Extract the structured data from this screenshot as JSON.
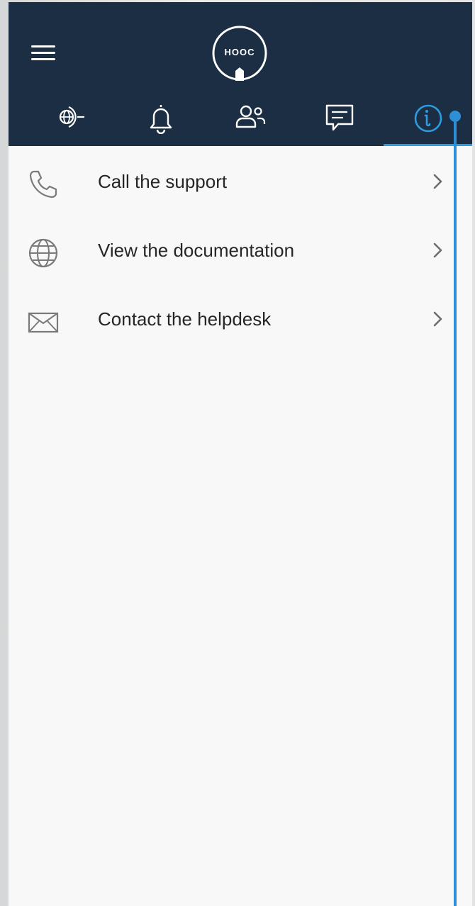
{
  "app": {
    "logo_text": "HOOC"
  },
  "header": {
    "menu_icon": "hamburger-menu-icon",
    "tabs": [
      {
        "icon": "network-connection-icon",
        "active": false
      },
      {
        "icon": "bell-icon",
        "active": false
      },
      {
        "icon": "users-icon",
        "active": false
      },
      {
        "icon": "chat-icon",
        "active": false
      },
      {
        "icon": "info-icon",
        "active": true
      }
    ]
  },
  "colors": {
    "header_bg": "#1b2e44",
    "accent": "#2e9be0",
    "content_bg": "#f8f8f8"
  },
  "support_menu": {
    "items": [
      {
        "label": "Call the support",
        "icon": "phone-icon"
      },
      {
        "label": "View the documentation",
        "icon": "globe-icon"
      },
      {
        "label": "Contact the helpdesk",
        "icon": "envelope-icon"
      }
    ]
  }
}
